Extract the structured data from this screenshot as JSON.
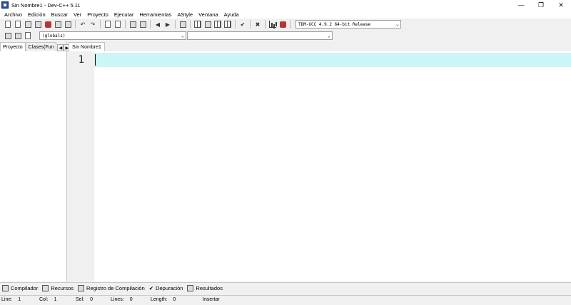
{
  "window": {
    "title": "Sin Nombre1 - Dev-C++ 5.11",
    "controls": {
      "minimize": "—",
      "maximize": "❐",
      "close": "✕"
    }
  },
  "menu": [
    "Archivo",
    "Edición",
    "Buscar",
    "Ver",
    "Proyecto",
    "Ejecutar",
    "Herramientas",
    "AStyle",
    "Ventana",
    "Ayuda"
  ],
  "toolbar": {
    "compiler_selected": "TDM-GCC 4.9.2 64-bit Release",
    "scope_selected": "(globals)",
    "function_selected": ""
  },
  "left_panel": {
    "tabs": [
      "Proyecto",
      "Clases(Fun"
    ]
  },
  "editor": {
    "tab": "Sin Nombre1",
    "line_numbers": [
      "1"
    ]
  },
  "bottom_tabs": [
    "Compilador",
    "Recursos",
    "Registro de Compilación",
    "Depuración",
    "Resultados"
  ],
  "status": {
    "line_label": "Line:",
    "line_value": "1",
    "col_label": "Col:",
    "col_value": "1",
    "sel_label": "Sel:",
    "sel_value": "0",
    "lines_label": "Lines:",
    "lines_value": "0",
    "length_label": "Length:",
    "length_value": "0",
    "mode": "Insertar"
  },
  "colors": {
    "current_line": "#ccf5f7",
    "gutter": "#f0f0f0"
  }
}
